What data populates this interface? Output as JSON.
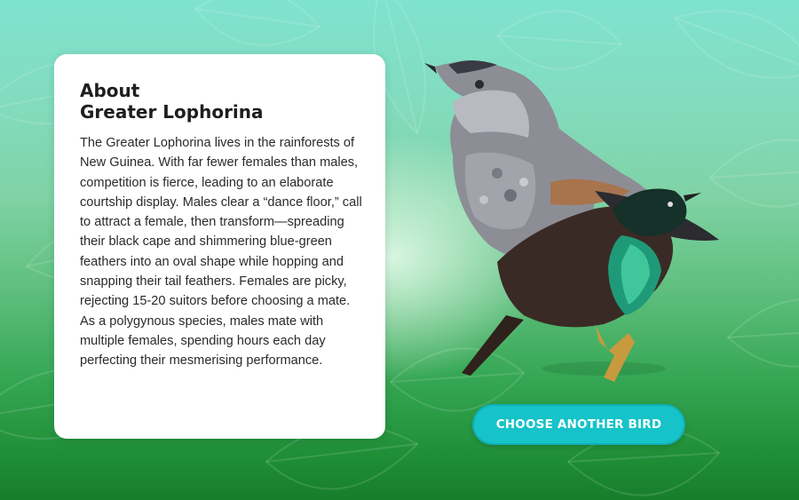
{
  "info_card": {
    "title_line1": "About",
    "title_line2": "Greater Lophorina",
    "body": "The Greater Lophorina lives in the rainforests of New Guinea. With far fewer females than males, competition is fierce, leading to an elaborate courtship display. Males clear a “dance floor,” call to attract a female, then transform—spreading their black cape and shimmering blue-green feathers into an oval shape while hopping and snapping their tail feathers. Females are picky, rejecting 15-20 suitors before choosing a mate. As a polygynous species, males mate with multiple females, spending hours each day perfecting their mesmerising performance."
  },
  "actions": {
    "choose_another_bird": "CHOOSE ANOTHER BIRD"
  },
  "illustration": {
    "subject": "greater-lophorina-pair-illustration",
    "background": "green-leaf-pattern"
  },
  "colors": {
    "button": "#16c3c8",
    "background_top": "#7fe3cf",
    "background_bottom": "#177e2b",
    "card": "#ffffff"
  }
}
